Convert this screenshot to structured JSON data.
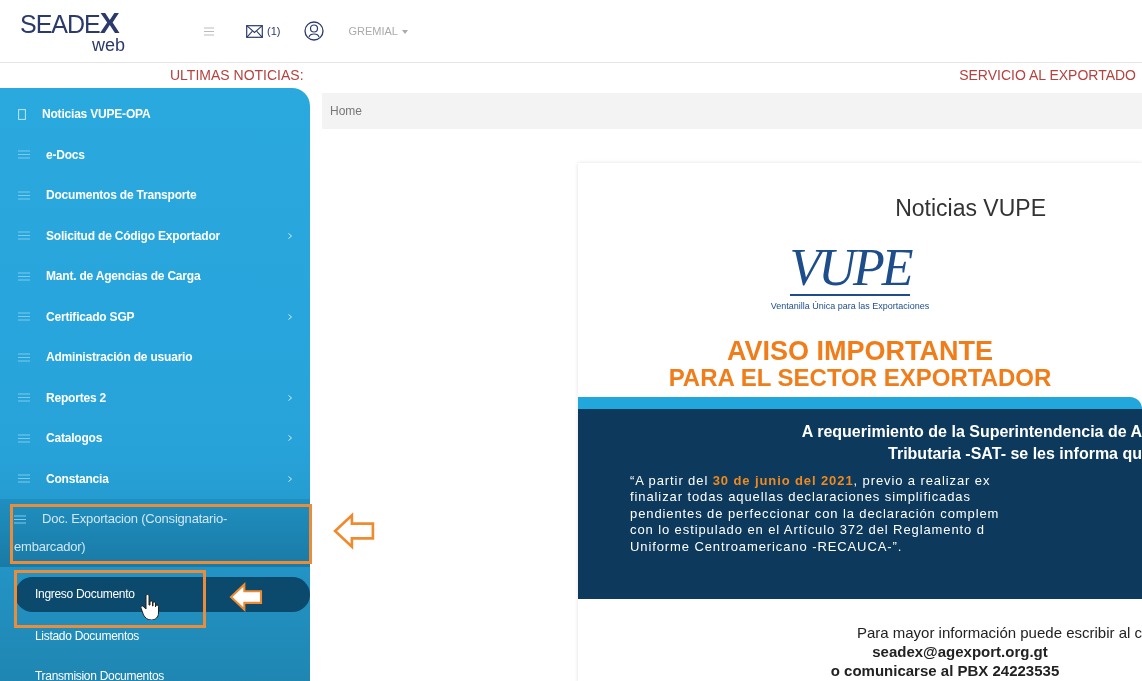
{
  "header": {
    "logo": {
      "name": "SEADE",
      "mark": "X",
      "sub": "web"
    },
    "messages_count": "(1)",
    "user_menu": "GREMIAL"
  },
  "ticker": {
    "left": "ULTIMAS NOTICIAS:",
    "right": "SERVICIO AL EXPORTADO"
  },
  "sidebar": {
    "items": [
      {
        "label": "Noticias VUPE-OPA",
        "kind": "page",
        "submenu": false,
        "expanded": false
      },
      {
        "label": "e-Docs",
        "kind": "list",
        "submenu": false,
        "expanded": false
      },
      {
        "label": "Documentos de Transporte",
        "kind": "list",
        "submenu": false,
        "expanded": false
      },
      {
        "label": "Solicitud de Código Exportador",
        "kind": "list",
        "submenu": true,
        "expanded": false
      },
      {
        "label": "Mant. de Agencias de Carga",
        "kind": "list",
        "submenu": false,
        "expanded": false
      },
      {
        "label": "Certificado SGP",
        "kind": "list",
        "submenu": true,
        "expanded": false
      },
      {
        "label": "Administración de usuario",
        "kind": "list",
        "submenu": false,
        "expanded": false
      },
      {
        "label": "Reportes 2",
        "kind": "list",
        "submenu": true,
        "expanded": false
      },
      {
        "label": "Catalogos",
        "kind": "list",
        "submenu": true,
        "expanded": false
      },
      {
        "label": "Constancia",
        "kind": "list",
        "submenu": true,
        "expanded": false
      },
      {
        "label": "Doc. Exportacion (Consignatario-embarcador)",
        "kind": "list",
        "submenu": false,
        "expanded": true,
        "children": [
          {
            "label": "Ingreso Documento",
            "selected": true
          },
          {
            "label": "Listado Documentos",
            "selected": false
          },
          {
            "label": "Transmision Documentos",
            "selected": false
          }
        ]
      }
    ]
  },
  "breadcrumb": [
    "Home"
  ],
  "news": {
    "title": "Noticias VUPE",
    "logo": "VUPE",
    "logo_caption": "Ventanilla Única para las Exportaciones",
    "headline": [
      "AVISO IMPORTANTE",
      "PARA EL SECTOR EXPORTADOR"
    ],
    "notice_heading": [
      "A requerimiento de la Superintendencia de A",
      "Tributaria -SAT- se les informa qu"
    ],
    "notice_body": [
      "“A partir del **30 de junio del 2021**, previo a realizar ex",
      "finalizar todas aquellas declaraciones simplificadas",
      "pendientes de perfeccionar con la declaración complem",
      "con lo estipulado en el Artículo 372 del Reglamento d",
      "Uniforme Centroamericano -RECAUCA-”."
    ],
    "contact": [
      "Para mayor información puede escribir al c",
      "seadex@agexport.org.gt",
      "o comunicarse al PBX 24223535"
    ]
  }
}
